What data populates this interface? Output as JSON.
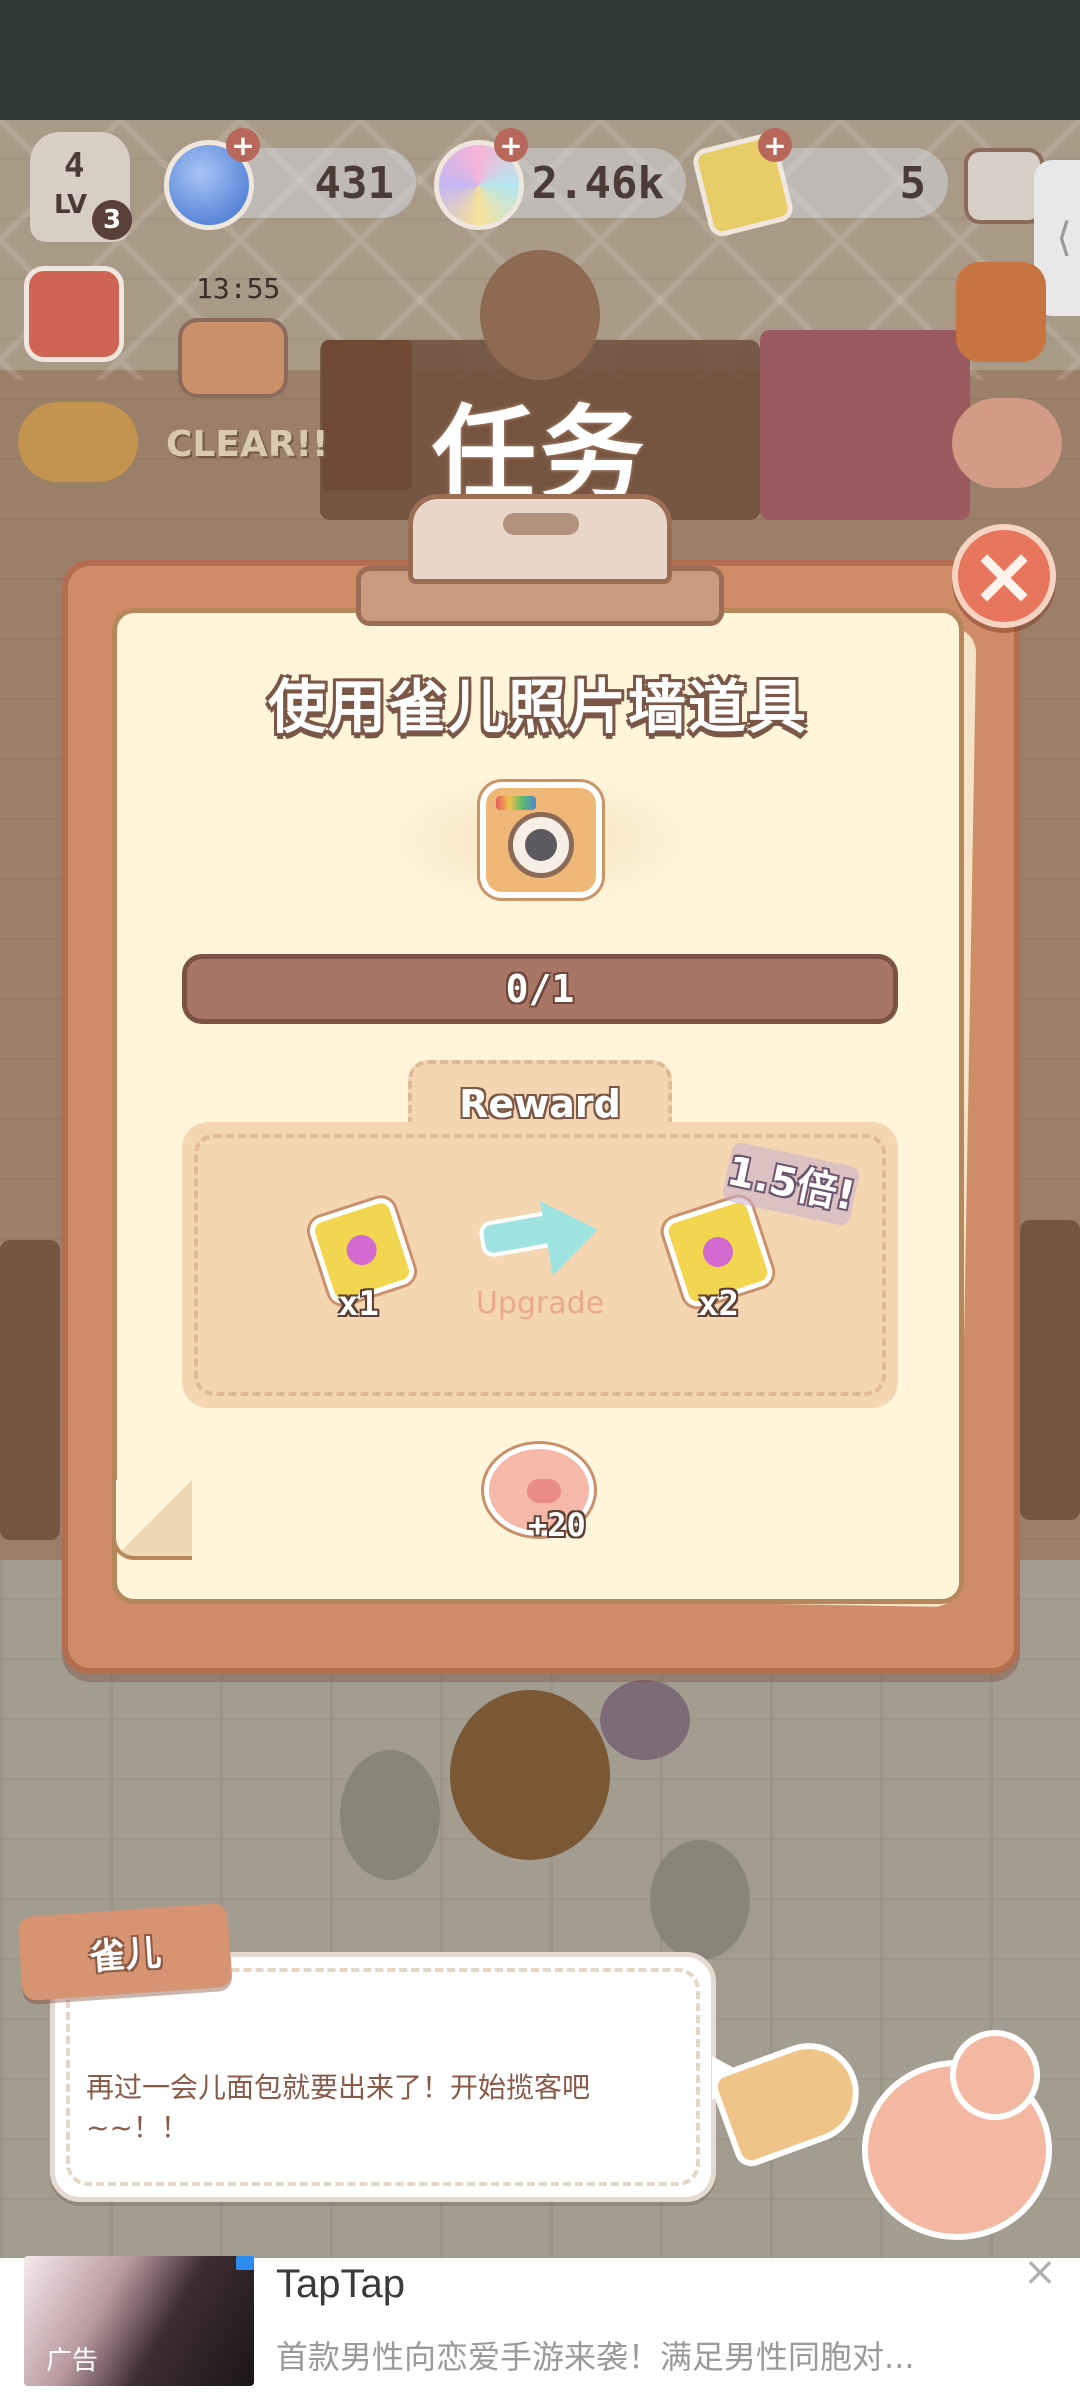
{
  "hud": {
    "level_label": "LV",
    "level_value": "4",
    "level_badge": "3",
    "gems": "431",
    "coins": "2.46k",
    "tickets": "5",
    "timer": "13:55",
    "clear_label": "CLEAR!!",
    "side_tab_glyph": "⟨",
    "plus_glyph": "+"
  },
  "modal": {
    "title": "任务",
    "task_name": "使用雀儿照片墙道具",
    "progress_text": "0/1",
    "progress_fraction": 0,
    "reward": {
      "label": "Reward",
      "base_multiplier": "x1",
      "upgrade_label": "Upgrade",
      "upgraded_multiplier": "x2",
      "bonus_tag": "1.5倍!"
    },
    "pig_bonus": "+20",
    "close_glyph": "×"
  },
  "dialogue": {
    "speaker": "雀儿",
    "text": "再过一会儿面包就要出来了！开始揽客吧~~！！"
  },
  "ad": {
    "label": "广告",
    "title": "TapTap",
    "description": "首款男性向恋爱手游来袭！满足男性同胞对...",
    "close_glyph": "×"
  },
  "colors": {
    "board": "#cf8d67",
    "paper": "#fff5db",
    "close_button": "#e8765c",
    "progress_track": "#a97567",
    "reward_panel": "#f4d6b2"
  },
  "icons": [
    "chef-hat-icon",
    "gem-icon",
    "coin-icon",
    "ticket-icon",
    "menu-list-icon",
    "calendar-icon",
    "dog-face-icon",
    "camera-icon",
    "arrow-right-icon",
    "piggy-bank-icon",
    "close-icon"
  ]
}
